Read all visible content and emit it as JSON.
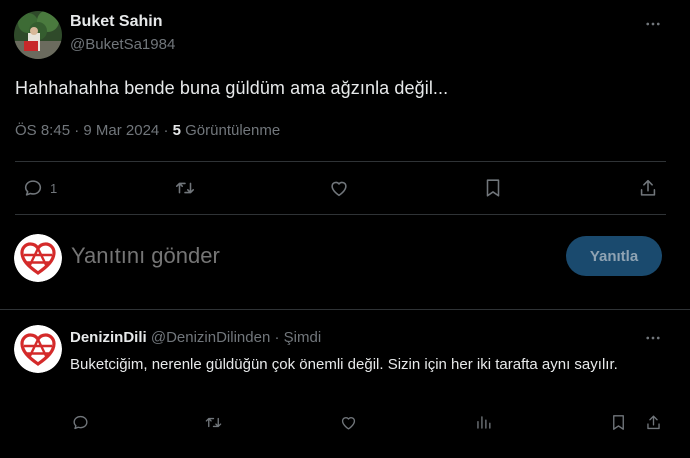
{
  "tweet": {
    "author_name": "Buket Sahin",
    "author_handle": "@BuketSa1984",
    "text": "Hahhahahha bende buna güldüm ama ağzınla değil...",
    "time": "ÖS 8:45",
    "date": "9 Mar 2024",
    "views_count": "5",
    "views_label": "Görüntülenme",
    "reply_count": "1"
  },
  "compose": {
    "placeholder": "Yanıtını gönder",
    "button_label": "Yanıtla"
  },
  "reply": {
    "author_name": "DenizinDili",
    "author_handle": "@DenizinDilinden",
    "time": "Şimdi",
    "text": "Buketciğim, nerenle güldüğün çok önemli değil. Sizin için her iki tarafta aynı sayılır."
  },
  "colors": {
    "background": "#000000",
    "text_primary": "#e7e9ea",
    "text_secondary": "#71767b",
    "divider": "#2f3336",
    "reply_button_bg": "#1a4a6e",
    "heart_logo": "#d42a2a"
  },
  "icons": {
    "more": "more-dots-icon",
    "reply": "reply-bubble-icon",
    "retweet": "retweet-icon",
    "like": "heart-icon",
    "bookmark": "bookmark-icon",
    "share": "share-icon",
    "views": "analytics-icon"
  }
}
